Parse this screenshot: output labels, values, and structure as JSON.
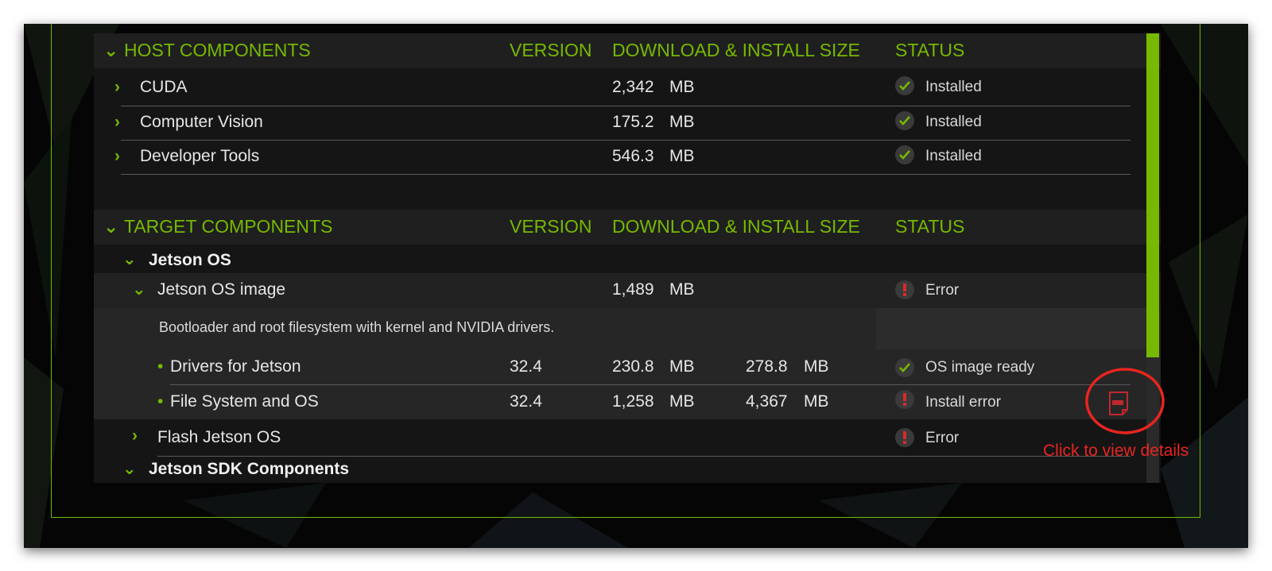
{
  "host": {
    "header": {
      "title": "HOST COMPONENTS",
      "version": "VERSION",
      "size": "DOWNLOAD & INSTALL SIZE",
      "status": "STATUS"
    },
    "rows": [
      {
        "name": "CUDA",
        "size": "2,342",
        "unit": "MB",
        "status": "Installed"
      },
      {
        "name": "Computer Vision",
        "size": "175.2",
        "unit": "MB",
        "status": "Installed"
      },
      {
        "name": "Developer Tools",
        "size": "546.3",
        "unit": "MB",
        "status": "Installed"
      }
    ]
  },
  "target": {
    "header": {
      "title": "TARGET COMPONENTS",
      "version": "VERSION",
      "size": "DOWNLOAD & INSTALL SIZE",
      "status": "STATUS"
    },
    "jetson_os": {
      "label": "Jetson OS"
    },
    "os_image": {
      "name": "Jetson OS image",
      "size": "1,489",
      "unit": "MB",
      "status": "Error",
      "description": "Bootloader and root filesystem with kernel and NVIDIA drivers."
    },
    "sub_items": [
      {
        "name": "Drivers for Jetson",
        "version": "32.4",
        "download": "230.8",
        "download_unit": "MB",
        "install": "278.8",
        "install_unit": "MB",
        "status": "OS image ready"
      },
      {
        "name": "File System and OS",
        "version": "32.4",
        "download": "1,258",
        "download_unit": "MB",
        "install": "4,367",
        "install_unit": "MB",
        "status": "Install error"
      }
    ],
    "flash": {
      "name": "Flash Jetson OS",
      "status": "Error"
    },
    "sdk": {
      "label": "Jetson SDK Components"
    }
  },
  "annotation": {
    "text": "Click to view details"
  },
  "colors": {
    "accent": "#76b900",
    "error": "#d62b2b",
    "annotation": "#e8251f"
  },
  "icons": {
    "ok": "checkmark-icon",
    "error": "exclamation-icon",
    "log": "log-file-icon"
  }
}
